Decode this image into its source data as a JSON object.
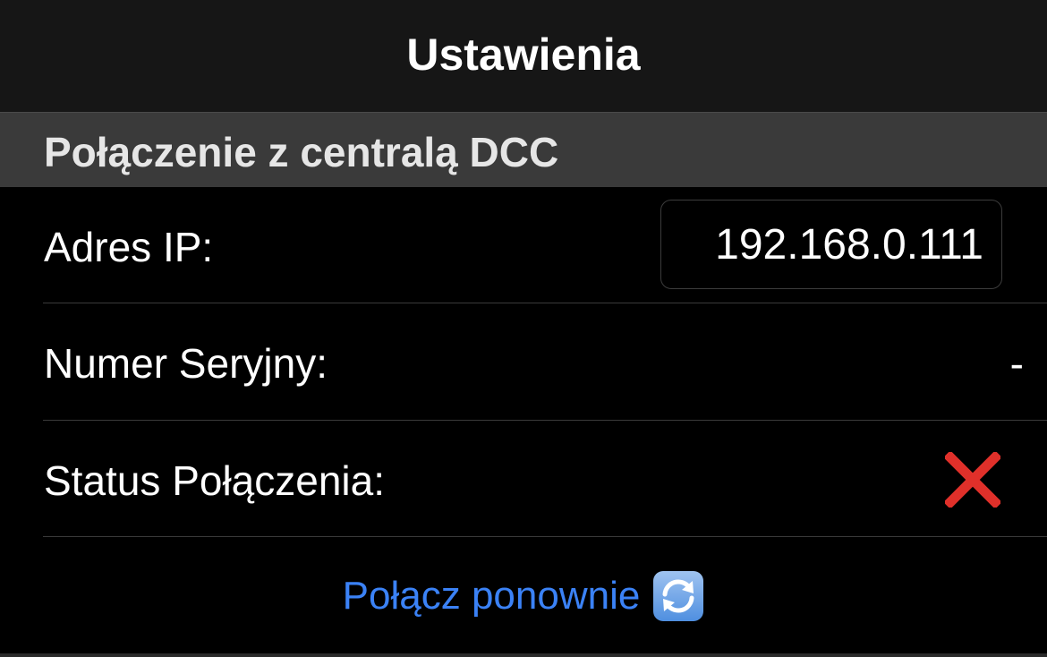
{
  "navbar": {
    "title": "Ustawienia"
  },
  "section": {
    "title": "Połączenie z centralą DCC"
  },
  "rows": {
    "ip": {
      "label": "Adres IP:",
      "value": "192.168.0.111"
    },
    "serial": {
      "label": "Numer Seryjny:",
      "value": "-"
    },
    "status": {
      "label": "Status Połączenia:",
      "icon": "red-x-icon",
      "state_color": "#e0302a"
    }
  },
  "reconnect": {
    "label": "Połącz ponownie",
    "icon": "refresh-icon",
    "color": "#3b82f6"
  }
}
